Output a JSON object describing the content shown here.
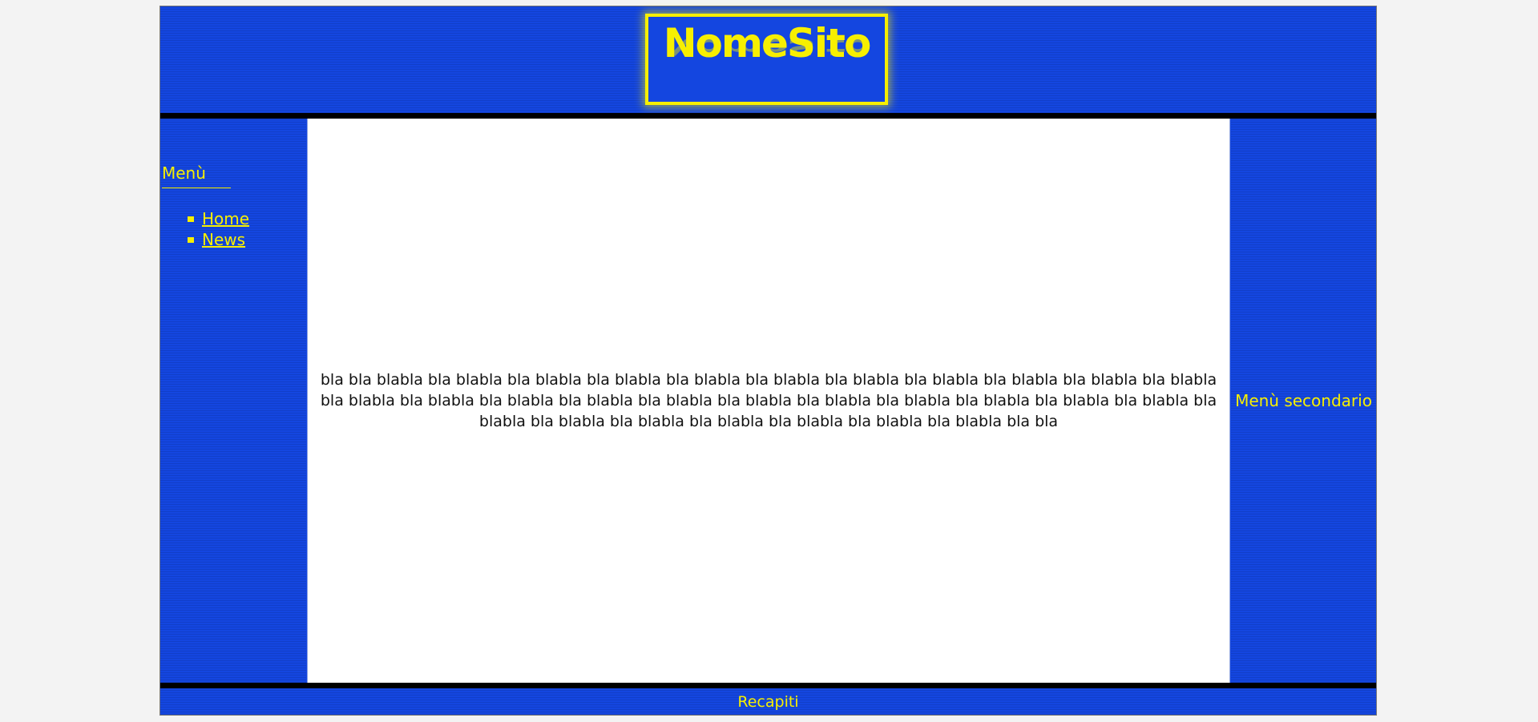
{
  "header": {
    "logo_text": "NomeSito"
  },
  "menu": {
    "title": "Menù",
    "items": [
      {
        "label": "Home"
      },
      {
        "label": "News"
      }
    ]
  },
  "content": {
    "text": "bla bla blabla bla blabla bla blabla bla blabla bla blabla bla blabla bla blabla bla blabla bla blabla bla blabla bla blabla bla blabla bla blabla bla blabla bla blabla bla blabla bla blabla bla blabla bla blabla bla blabla bla blabla bla blabla bla blabla bla blabla bla blabla bla blabla bla blabla bla blabla bla blabla bla bla"
  },
  "secondary_menu": {
    "title": "Menù secondario"
  },
  "footer": {
    "text": "Recapiti"
  },
  "colors": {
    "page_background": "#f3f3f3",
    "panel_blue": "#1446e0",
    "accent_yellow": "#f7ef00",
    "separator": "#000000",
    "content_background": "#ffffff"
  }
}
